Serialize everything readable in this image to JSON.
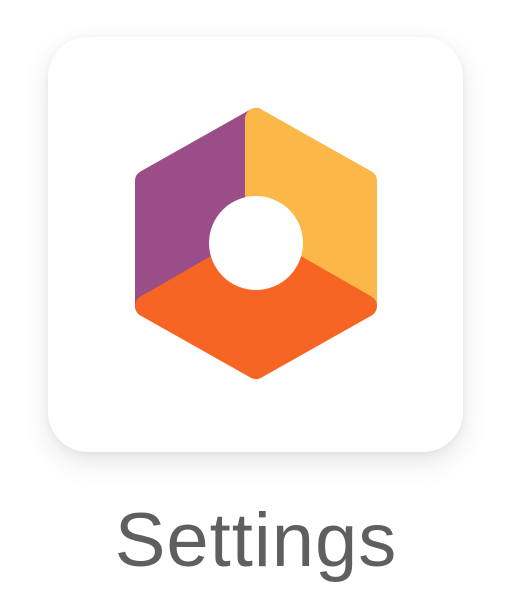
{
  "app": {
    "label": "Settings",
    "icon": "settings-hexagon-icon"
  },
  "colors": {
    "purple": "#9a4d86",
    "yellow": "#fbb848",
    "orange": "#f76525",
    "label": "#5f5f5f",
    "tile": "#ffffff"
  }
}
